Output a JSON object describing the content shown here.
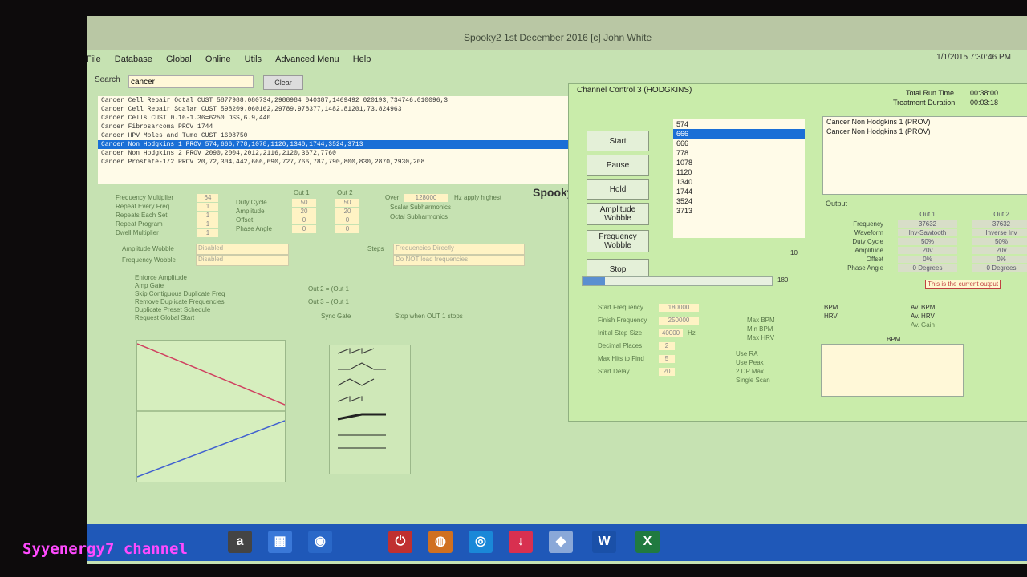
{
  "window": {
    "title": "Spooky2 1st December 2016 [c] John White",
    "date": "1/1/2015 7:30:46 PM"
  },
  "menu": [
    "File",
    "Database",
    "Global",
    "Online",
    "Utils",
    "Advanced Menu",
    "Help"
  ],
  "search": {
    "label": "Search",
    "value": "cancer",
    "clear": "Clear"
  },
  "programs": [
    {
      "name": "Cancer Cell Repair Octal",
      "src": "CUST",
      "freqs": "5877988.080734,2988984 040387,1469492 020193,734746.010096,3"
    },
    {
      "name": "Cancer Cell Repair Scalar",
      "src": "CUST",
      "freqs": "598209.060162,29789.978377,1482.81201,73.824963"
    },
    {
      "name": "Cancer Cells",
      "src": "CUST",
      "freqs": "0.16-1.36=6250 DSS,6.9,440"
    },
    {
      "name": "Cancer Fibrosarcoma",
      "src": "PROV",
      "freqs": "1744"
    },
    {
      "name": "Cancer HPV Moles and Tumo",
      "src": "CUST",
      "freqs": "1608750"
    },
    {
      "name": "Cancer Non Hodgkins 1",
      "src": "PROV",
      "freqs": "574,666,778,1078,1120,1340,1744,3524,3713",
      "sel": true
    },
    {
      "name": "Cancer Non Hodgkins 2",
      "src": "PROV",
      "freqs": "2090,2004,2012,2116,2120,3672,7760"
    },
    {
      "name": "Cancer Prostate-1/2",
      "src": "PROV",
      "freqs": "20,72,304,442,666,690,727,766,787,790,800,830,2870,2930,208"
    }
  ],
  "settings": {
    "labels": [
      "Frequency Multiplier",
      "Repeat Every Freq",
      "Repeats Each Set",
      "Repeat Program",
      "Dwell Multiplier"
    ],
    "values": [
      "64",
      "1",
      "1",
      "1",
      "1"
    ],
    "out_labels": [
      "Duty Cycle",
      "Amplitude",
      "Offset",
      "Phase Angle"
    ],
    "out1": [
      "50",
      "20",
      "0",
      "0"
    ],
    "out2": [
      "50",
      "20",
      "0",
      "0"
    ],
    "out1_head": "Out 1",
    "out2_head": "Out 2",
    "over": "Over",
    "over_val": "128000",
    "over_note": "Hz apply highest",
    "scalar": "Scalar Subharmonics",
    "octal": "Octal Subharmonics",
    "amp_wobble": "Amplitude Wobble",
    "freq_wobble": "Frequency Wobble",
    "amp_sel": "Disabled",
    "freq_sel": "Disabled",
    "steps": "Steps",
    "steps_val": "Frequencies Directly",
    "steps_val2": "Do NOT load frequencies",
    "ch_opts": [
      "Enforce Amplitude",
      "Amp Gate",
      "Skip Contiguous Duplicate Freq",
      "Remove Duplicate Frequencies",
      "Duplicate Preset Schedule",
      "Request Global Start"
    ],
    "gate": "Sync Gate",
    "gate_opt": "Stop when OUT 1 stops",
    "eq1": "Out 2 = (Out 1",
    "eq2": "Out 3 = (Out 1"
  },
  "control": {
    "title": "Channel Control 3 (HODGKINS)",
    "total_run": "Total Run Time",
    "total_run_val": "00:38:00",
    "duration": "Treatment Duration",
    "duration_val": "00:03:18",
    "buttons": [
      "Start",
      "Pause",
      "Hold",
      "Amplitude Wobble",
      "Frequency Wobble",
      "Stop"
    ],
    "freqs": [
      "574",
      "666",
      "666",
      "778",
      "1078",
      "1120",
      "1340",
      "1744",
      "3524",
      "3713"
    ],
    "freq_count": "10",
    "progress": "180",
    "prog_list": [
      "Cancer Non Hodgkins 1 (PROV)",
      "Cancer Non Hodgkins 1 (PROV)"
    ],
    "output_head": "Output",
    "out1_head": "Out 1",
    "out2_head": "Out 2",
    "out_rows": [
      {
        "k": "Frequency",
        "v1": "37632",
        "v2": "37632"
      },
      {
        "k": "Waveform",
        "v1": "Inv-Sawtooth",
        "v2": "Inverse Inv"
      },
      {
        "k": "Duty Cycle",
        "v1": "50%",
        "v2": "50%"
      },
      {
        "k": "Amplitude",
        "v1": "20v",
        "v2": "20v"
      },
      {
        "k": "Offset",
        "v1": "0%",
        "v2": "0%"
      },
      {
        "k": "Phase Angle",
        "v1": "0 Degrees",
        "v2": "0 Degrees"
      }
    ],
    "tooltip": "This is the current output",
    "bpm": "BPM",
    "hrv": "HRV",
    "av_bpm": "Av. BPM",
    "av_hrv": "Av. HRV",
    "av_gain": "Av. Gain",
    "bpm_chart": "BPM",
    "scan_labels": [
      "Start Frequency",
      "Finish Frequency",
      "Initial Step Size",
      "Decimal Places",
      "Max Hits to Find",
      "Start Delay"
    ],
    "scan_vals": [
      "180000",
      "250000",
      "40000",
      "2",
      "5",
      "20"
    ],
    "scan_unit": "Hz",
    "scan_opts": [
      "Max BPM",
      "Min BPM",
      "Max HRV"
    ],
    "scan_opts2": [
      "Use RA",
      "Use Peak",
      "2 DP Max",
      "Single Scan"
    ]
  },
  "spooky_logo": "Spooky",
  "channel": "Syyenergy7 channel"
}
